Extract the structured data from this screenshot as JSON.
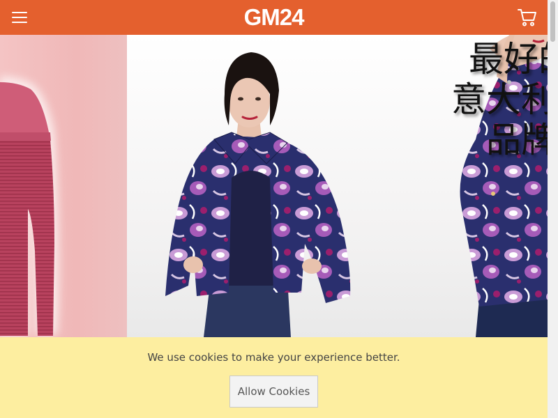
{
  "header": {
    "logo": "GM24",
    "menu_icon": "hamburger-menu-icon",
    "cart_icon": "shopping-cart-icon",
    "background": "#e4602e"
  },
  "hero": {
    "slogan_lines": [
      "最好的",
      "意大利语",
      "品牌"
    ]
  },
  "cookie_banner": {
    "message": "We use cookies to make your experience better.",
    "button_label": "Allow Cookies",
    "background": "#fdeea0"
  }
}
